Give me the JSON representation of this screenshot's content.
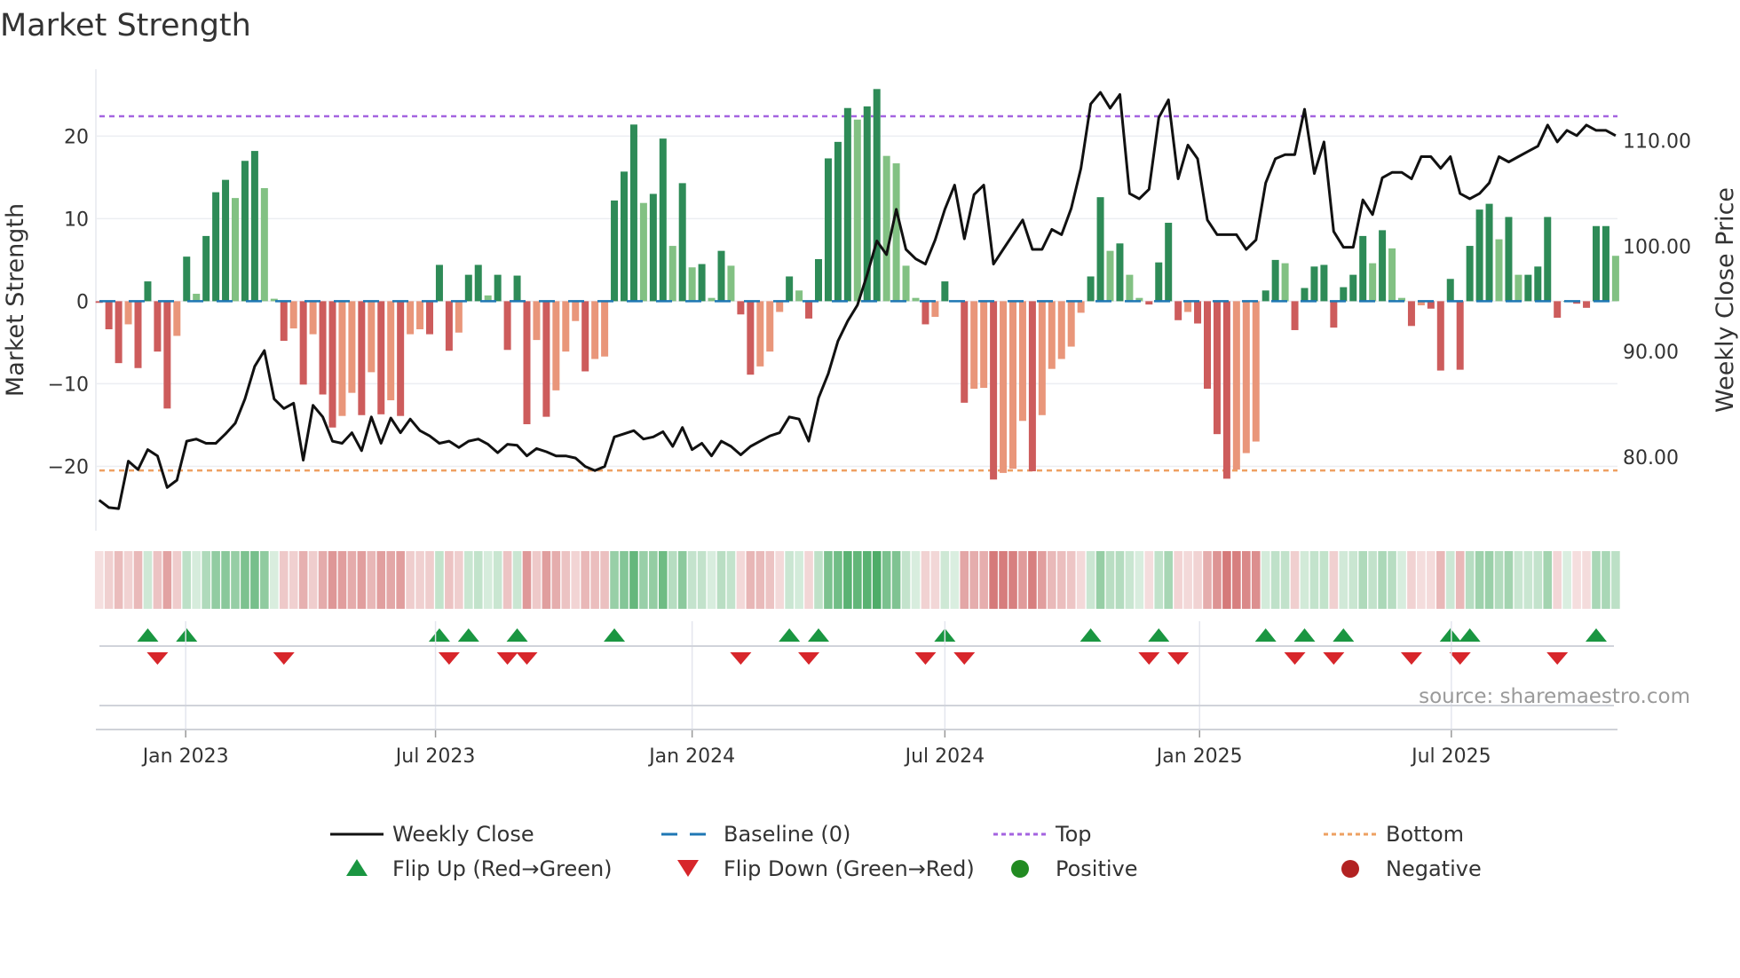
{
  "chart_data": {
    "type": "bar",
    "title": "Market Strength",
    "ylabel": "Market Strength",
    "y2label": "Weekly Close Price",
    "ylim": [
      -27.8,
      28.1
    ],
    "y2lim": [
      73.0,
      116.8
    ],
    "yticks": [
      -20,
      -10,
      0,
      10,
      20
    ],
    "yticklabels": [
      "−20",
      "−10",
      "0",
      "10",
      "20"
    ],
    "y2ticks": [
      80,
      90,
      100,
      110
    ],
    "y2ticklabels": [
      "80.00",
      "90.00",
      "100.00",
      "110.00"
    ],
    "xticks": [
      {
        "week": 8.9,
        "label": "Jan 2023"
      },
      {
        "week": 34.6,
        "label": "Jul 2023"
      },
      {
        "week": 61.0,
        "label": "Jan 2024"
      },
      {
        "week": 87.0,
        "label": "Jul 2024"
      },
      {
        "week": 113.2,
        "label": "Jan 2025"
      },
      {
        "week": 139.1,
        "label": "Jul 2025"
      }
    ],
    "top_level": 22.4,
    "bottom_level": -20.5,
    "baseline": 0,
    "strength": [
      -0.2,
      -3.4,
      -7.5,
      -2.8,
      -8.1,
      2.4,
      -6.1,
      -13,
      -4.2,
      5.4,
      0.9,
      7.9,
      13.2,
      14.7,
      12.5,
      17,
      18.2,
      13.7,
      0.3,
      -4.8,
      -3.3,
      -10.1,
      -4,
      -11.3,
      -15.3,
      -13.9,
      -11.1,
      -13.8,
      -8.6,
      -13.7,
      -12,
      -13.9,
      -4,
      -3.4,
      -4,
      4.4,
      -6,
      -3.8,
      3.2,
      4.4,
      0.7,
      3.2,
      -5.9,
      3.1,
      -14.9,
      -4.7,
      -14,
      -10.8,
      -6.1,
      -2.4,
      -8.5,
      -7,
      -6.7,
      12.2,
      15.7,
      21.4,
      11.9,
      13,
      19.7,
      6.7,
      14.3,
      4.1,
      4.5,
      0.4,
      6.1,
      4.3,
      -1.6,
      -8.9,
      -7.9,
      -6.1,
      -1.3,
      3,
      1.3,
      -2.1,
      5.1,
      17.3,
      19.3,
      23.4,
      22,
      23.6,
      25.7,
      17.6,
      16.7,
      4.3,
      0.4,
      -2.8,
      -1.9,
      2.4,
      0,
      -12.3,
      -10.6,
      -10.5,
      -21.6,
      -20.8,
      -20.3,
      -14.5,
      -20.6,
      -13.8,
      -8.2,
      -7,
      -5.5,
      -1.4,
      3,
      12.6,
      6.1,
      7,
      3.2,
      0.4,
      -0.4,
      4.7,
      9.5,
      -2.3,
      -1.3,
      -2.7,
      -10.6,
      -16.1,
      -21.5,
      -20.4,
      -18.4,
      -17,
      1.3,
      5,
      4.6,
      -3.5,
      1.6,
      4.2,
      4.4,
      -3.2,
      1.7,
      3.2,
      7.9,
      4.6,
      8.6,
      6.4,
      0.4,
      -3,
      -0.5,
      -0.9,
      -8.4,
      2.7,
      -8.3,
      6.7,
      11.1,
      11.8,
      7.5,
      10.2,
      3.2,
      3.2,
      4.2,
      10.2,
      -2,
      0,
      -0.3,
      -0.8,
      9.1,
      9.1,
      5.5
    ],
    "weekly_close": [
      75.9,
      75.2,
      75.1,
      79.6,
      78.8,
      80.7,
      80.1,
      77.1,
      77.8,
      81.5,
      81.7,
      81.3,
      81.3,
      82.2,
      83.2,
      85.5,
      88.6,
      90.1,
      85.5,
      84.6,
      85.1,
      79.7,
      84.9,
      83.8,
      81.5,
      81.3,
      82.3,
      80.6,
      83.8,
      81.3,
      83.7,
      82.3,
      83.6,
      82.5,
      82,
      81.3,
      81.5,
      80.9,
      81.5,
      81.7,
      81.2,
      80.4,
      81.2,
      81.1,
      80.1,
      80.8,
      80.5,
      80.1,
      80.1,
      79.9,
      79.1,
      78.7,
      79.1,
      81.9,
      82.2,
      82.5,
      81.7,
      81.9,
      82.4,
      81,
      82.8,
      80.7,
      81.3,
      80.1,
      81.5,
      81,
      80.2,
      81,
      81.5,
      82,
      82.3,
      83.8,
      83.6,
      81.5,
      85.6,
      87.9,
      91,
      92.9,
      94.4,
      97.3,
      100.5,
      99.2,
      103.5,
      99.7,
      98.8,
      98.3,
      100.6,
      103.5,
      105.8,
      100.7,
      104.9,
      105.8,
      98.3,
      99.7,
      101.1,
      102.5,
      99.7,
      99.7,
      101.6,
      101.1,
      103.6,
      107.4,
      113.5,
      114.6,
      113.1,
      114.4,
      105,
      104.5,
      105.4,
      112.2,
      113.9,
      106.4,
      109.6,
      108.3,
      102.5,
      101.1,
      101.1,
      101.1,
      99.7,
      100.6,
      106,
      108.3,
      108.7,
      108.7,
      113,
      106.9,
      109.9,
      101.4,
      99.9,
      99.9,
      104.4,
      103,
      106.5,
      107,
      107,
      106.4,
      108.5,
      108.5,
      107.4,
      108.5,
      105,
      104.5,
      105,
      106,
      108.5,
      108,
      108.5,
      109,
      109.5,
      111.5,
      109.9,
      111,
      110.5,
      111.5,
      111,
      111,
      110.5
    ],
    "flip_up_weeks": [
      5,
      9,
      35,
      38,
      43,
      53,
      71,
      74,
      87,
      102,
      109,
      120,
      124,
      128,
      139,
      141,
      154
    ],
    "flip_down_weeks": [
      6,
      19,
      36,
      42,
      44,
      66,
      73,
      85,
      89,
      108,
      111,
      123,
      127,
      135,
      140,
      150
    ],
    "grid": true,
    "legend_position": "bottom",
    "legend": [
      {
        "label": "Weekly Close",
        "kind": "line"
      },
      {
        "label": "Baseline (0)",
        "kind": "dash"
      },
      {
        "label": "Top",
        "kind": "dot-top"
      },
      {
        "label": "Bottom",
        "kind": "dot-bottom"
      },
      {
        "label": "Flip Up (Red→Green)",
        "kind": "tri-up"
      },
      {
        "label": "Flip Down (Green→Red)",
        "kind": "tri-down"
      },
      {
        "label": "Positive",
        "kind": "dot-pos"
      },
      {
        "label": "Negative",
        "kind": "dot-neg"
      }
    ],
    "source": "source: sharemaestro.com"
  },
  "colors": {
    "pos_strong": "#2e8b57",
    "pos_weak": "#82c183",
    "neg_strong": "#cd5c5c",
    "neg_weak": "#e9967a",
    "close": "#111111",
    "baseline": "#1f77b4",
    "top": "#a463e0",
    "bottom": "#eea062",
    "flip_up": "#1a9641",
    "flip_down": "#d7262b",
    "positive": "#228b22",
    "negative": "#b22222"
  }
}
